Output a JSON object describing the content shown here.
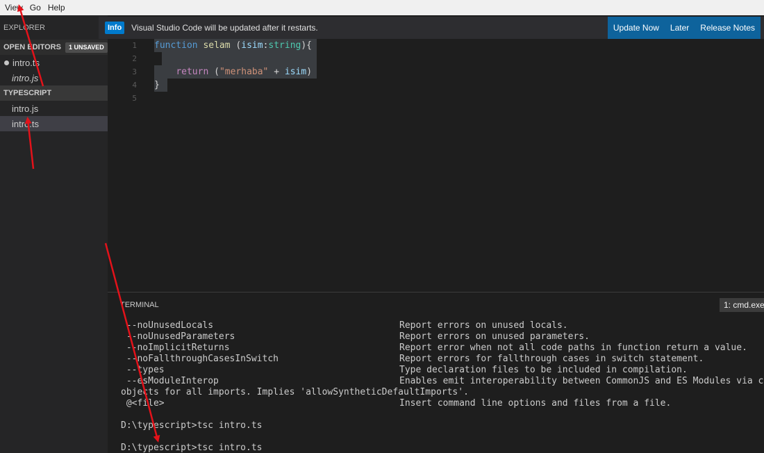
{
  "menu": [
    "View",
    "Go",
    "Help"
  ],
  "sidebar": {
    "title": "EXPLORER",
    "open_editors": {
      "label": "OPEN EDITORS",
      "badge": "1 UNSAVED",
      "files": [
        "intro.ts",
        "intro.js"
      ]
    },
    "folder": {
      "label": "TYPESCRIPT",
      "files": [
        "intro.js",
        "intro.ts"
      ]
    }
  },
  "notification": {
    "tag": "Info",
    "message": "Visual Studio Code will be updated after it restarts.",
    "actions": [
      "Update Now",
      "Later",
      "Release Notes"
    ]
  },
  "editor": {
    "line_numbers": [
      "1",
      "2",
      "3",
      "4",
      "5"
    ],
    "code": {
      "l1_kw": "function",
      "l1_name": "selam",
      "l1_open": " (",
      "l1_param": "isim",
      "l1_colon": ":",
      "l1_type": "string",
      "l1_close": "){",
      "l3_kw": "return",
      "l3_open": " (",
      "l3_str": "\"merhaba\"",
      "l3_plus": " + ",
      "l3_param": "isim",
      "l3_close": ")",
      "l4": "}"
    }
  },
  "panel": {
    "title": "TERMINAL",
    "terminal_select": "1: cmd.exe",
    "lines": [
      {
        "opt": " --noUnusedLocals",
        "desc": "Report errors on unused locals."
      },
      {
        "opt": " --noUnusedParameters",
        "desc": "Report errors on unused parameters."
      },
      {
        "opt": " --noImplicitReturns",
        "desc": "Report error when not all code paths in function return a value."
      },
      {
        "opt": " --noFallthroughCasesInSwitch",
        "desc": "Report errors for fallthrough cases in switch statement."
      },
      {
        "opt": " --types",
        "desc": "Type declaration files to be included in compilation."
      },
      {
        "opt": " --esModuleInterop",
        "desc": "Enables emit interoperability between CommonJS and ES Modules via creation of namespace"
      },
      {
        "opt": "objects for all imports. Implies 'allowSyntheticDefaultImports'.",
        "desc": ""
      },
      {
        "opt": " @<file>",
        "desc": "Insert command line options and files from a file."
      },
      {
        "opt": "",
        "desc": ""
      },
      {
        "opt": "D:\\typescript>tsc intro.ts",
        "desc": ""
      },
      {
        "opt": "",
        "desc": ""
      },
      {
        "opt": "D:\\typescript>tsc intro.ts",
        "desc": ""
      }
    ]
  },
  "colors": {
    "accent": "#007acc",
    "annotation_arrow": "#e3121a"
  }
}
